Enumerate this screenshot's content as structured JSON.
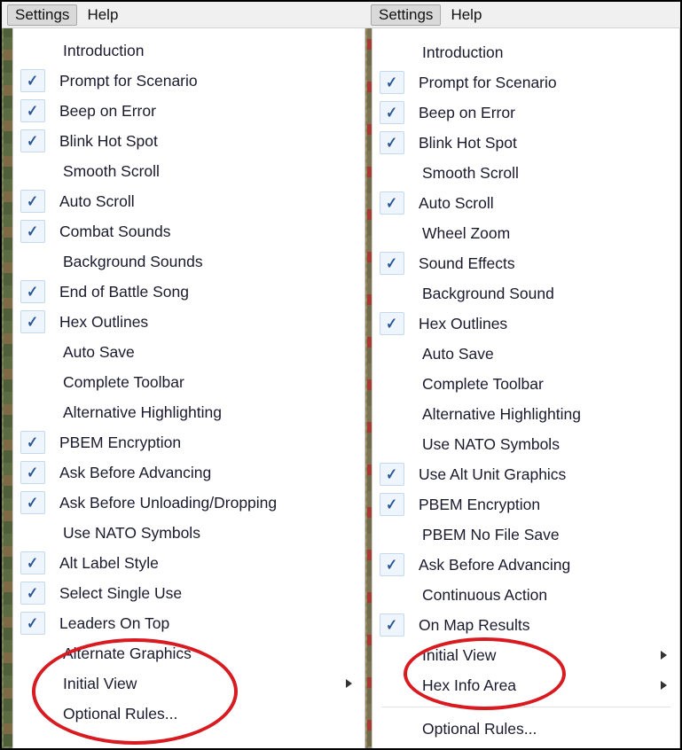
{
  "window": {
    "title": "Settings menu comparison",
    "accent_annotation_color": "#d81b20",
    "check_color": "#2b5797"
  },
  "panels": [
    {
      "id": "left-panel",
      "menubar": [
        {
          "label": "Settings",
          "active": true
        },
        {
          "label": "Help",
          "active": false
        }
      ],
      "menu_items": [
        {
          "label": "Introduction",
          "checked": false,
          "submenu": false
        },
        {
          "label": "Prompt for Scenario",
          "checked": true,
          "submenu": false
        },
        {
          "label": "Beep on Error",
          "checked": true,
          "submenu": false
        },
        {
          "label": "Blink Hot Spot",
          "checked": true,
          "submenu": false
        },
        {
          "label": "Smooth Scroll",
          "checked": false,
          "submenu": false
        },
        {
          "label": "Auto Scroll",
          "checked": true,
          "submenu": false
        },
        {
          "label": "Combat Sounds",
          "checked": true,
          "submenu": false
        },
        {
          "label": "Background Sounds",
          "checked": false,
          "submenu": false
        },
        {
          "label": "End of Battle Song",
          "checked": true,
          "submenu": false
        },
        {
          "label": "Hex Outlines",
          "checked": true,
          "submenu": false
        },
        {
          "label": "Auto Save",
          "checked": false,
          "submenu": false
        },
        {
          "label": "Complete Toolbar",
          "checked": false,
          "submenu": false
        },
        {
          "label": "Alternative Highlighting",
          "checked": false,
          "submenu": false
        },
        {
          "label": "PBEM Encryption",
          "checked": true,
          "submenu": false
        },
        {
          "label": "Ask Before Advancing",
          "checked": true,
          "submenu": false
        },
        {
          "label": "Ask Before Unloading/Dropping",
          "checked": true,
          "submenu": false
        },
        {
          "label": "Use NATO Symbols",
          "checked": false,
          "submenu": false
        },
        {
          "label": "Alt Label Style",
          "checked": true,
          "submenu": false
        },
        {
          "label": "Select Single Use",
          "checked": true,
          "submenu": false
        },
        {
          "label": "Leaders On Top",
          "checked": true,
          "submenu": false
        },
        {
          "label": "Alternate Graphics",
          "checked": false,
          "submenu": false
        },
        {
          "label": "Initial View",
          "checked": false,
          "submenu": true
        },
        {
          "label": "Optional Rules...",
          "checked": false,
          "submenu": false
        }
      ]
    },
    {
      "id": "right-panel",
      "menubar": [
        {
          "label": "Settings",
          "active": true
        },
        {
          "label": "Help",
          "active": false
        }
      ],
      "menu_items": [
        {
          "label": "Introduction",
          "checked": false,
          "submenu": false
        },
        {
          "label": "Prompt for Scenario",
          "checked": true,
          "submenu": false
        },
        {
          "label": "Beep on Error",
          "checked": true,
          "submenu": false
        },
        {
          "label": "Blink Hot Spot",
          "checked": true,
          "submenu": false
        },
        {
          "label": "Smooth Scroll",
          "checked": false,
          "submenu": false
        },
        {
          "label": "Auto Scroll",
          "checked": true,
          "submenu": false
        },
        {
          "label": "Wheel Zoom",
          "checked": false,
          "submenu": false
        },
        {
          "label": "Sound Effects",
          "checked": true,
          "submenu": false
        },
        {
          "label": "Background Sound",
          "checked": false,
          "submenu": false
        },
        {
          "label": "Hex Outlines",
          "checked": true,
          "submenu": false
        },
        {
          "label": "Auto Save",
          "checked": false,
          "submenu": false
        },
        {
          "label": "Complete Toolbar",
          "checked": false,
          "submenu": false
        },
        {
          "label": "Alternative Highlighting",
          "checked": false,
          "submenu": false
        },
        {
          "label": "Use NATO Symbols",
          "checked": false,
          "submenu": false
        },
        {
          "label": "Use Alt Unit Graphics",
          "checked": true,
          "submenu": false
        },
        {
          "label": "PBEM Encryption",
          "checked": true,
          "submenu": false
        },
        {
          "label": "PBEM No File Save",
          "checked": false,
          "submenu": false
        },
        {
          "label": "Ask Before Advancing",
          "checked": true,
          "submenu": false
        },
        {
          "label": "Continuous Action",
          "checked": false,
          "submenu": false
        },
        {
          "label": "On Map Results",
          "checked": true,
          "submenu": false
        },
        {
          "label": "Initial View",
          "checked": false,
          "submenu": true
        },
        {
          "label": "Hex Info Area",
          "checked": false,
          "submenu": true
        },
        {
          "label": "Optional Rules...",
          "checked": false,
          "submenu": false
        }
      ]
    }
  ],
  "annotations": [
    {
      "shape": "ellipse",
      "target": "left-initial-view-group",
      "color": "#d81b20"
    },
    {
      "shape": "ellipse",
      "target": "right-initial-view-group",
      "color": "#d81b20"
    }
  ]
}
